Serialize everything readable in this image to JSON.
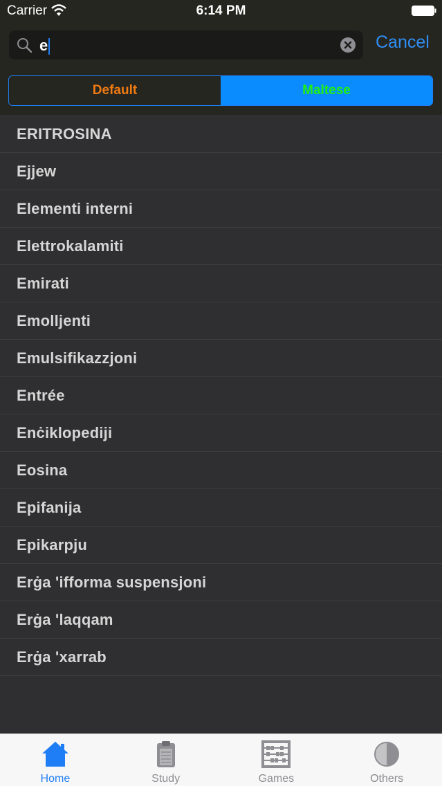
{
  "status_bar": {
    "carrier": "Carrier",
    "time": "6:14 PM"
  },
  "search": {
    "value": "e",
    "cancel_label": "Cancel"
  },
  "segments": {
    "default_label": "Default",
    "maltese_label": "Maltese",
    "selected": "Maltese"
  },
  "results": [
    "ERITROSINA",
    "Ejjew",
    "Elementi interni",
    "Elettrokalamiti",
    "Emirati",
    "Emolljenti",
    "Emulsifikazzjoni",
    "Entrée",
    "Enċiklopediji",
    "Eosina",
    "Epifanija",
    "Epikarpju",
    "Erġa 'ifforma suspensjoni",
    "Erġa 'laqqam",
    "Erġa 'xarrab"
  ],
  "tabs": [
    {
      "label": "Home",
      "icon": "home-icon",
      "active": true
    },
    {
      "label": "Study",
      "icon": "clipboard-icon",
      "active": false
    },
    {
      "label": "Games",
      "icon": "abacus-icon",
      "active": false
    },
    {
      "label": "Others",
      "icon": "half-circle-icon",
      "active": false
    }
  ],
  "colors": {
    "accent": "#1f7ef5",
    "default_segment_text": "#f07b12",
    "maltese_segment_text": "#1ef00e"
  }
}
